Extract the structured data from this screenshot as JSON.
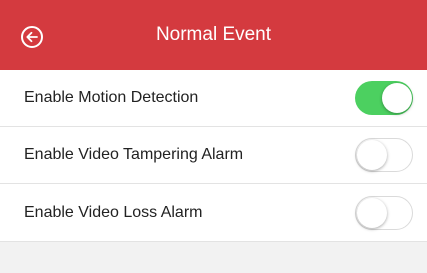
{
  "header": {
    "title": "Normal Event",
    "background": "#d43a3f",
    "back_icon": "back-arrow-circle-icon"
  },
  "settings": [
    {
      "label": "Enable Motion Detection",
      "enabled": true
    },
    {
      "label": "Enable Video Tampering Alarm",
      "enabled": false
    },
    {
      "label": "Enable Video Loss Alarm",
      "enabled": false
    }
  ],
  "colors": {
    "toggle_on": "#4cd060",
    "toggle_off": "#ffffff"
  }
}
